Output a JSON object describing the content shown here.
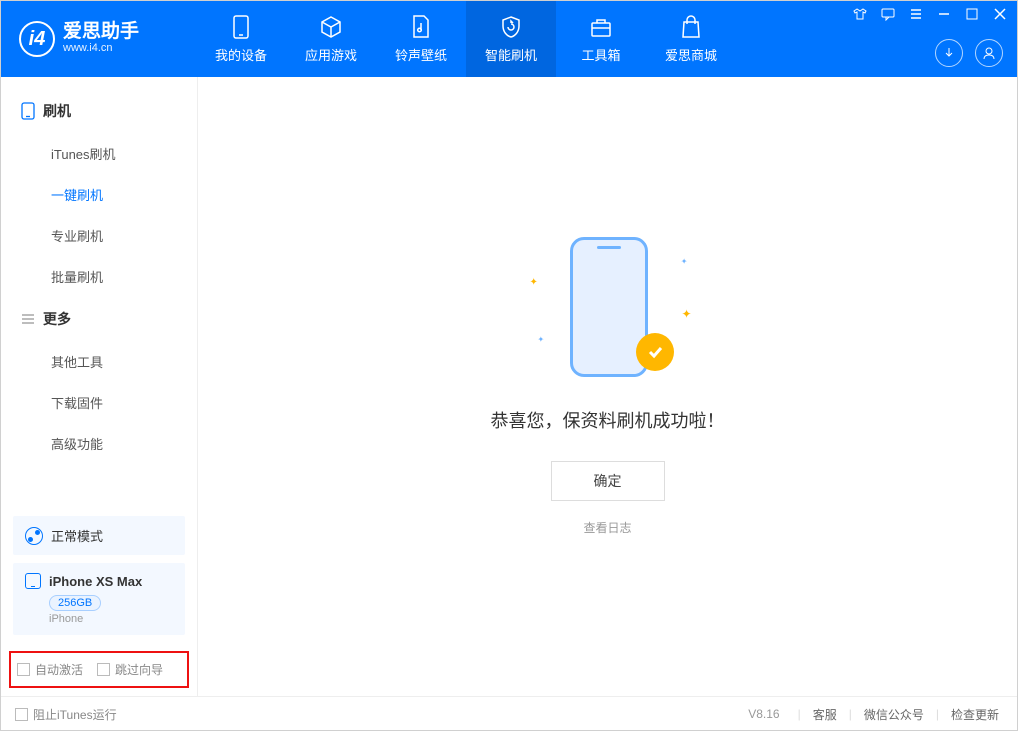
{
  "app": {
    "title": "爱思助手",
    "subtitle": "www.i4.cn"
  },
  "nav": [
    {
      "label": "我的设备"
    },
    {
      "label": "应用游戏"
    },
    {
      "label": "铃声壁纸"
    },
    {
      "label": "智能刷机"
    },
    {
      "label": "工具箱"
    },
    {
      "label": "爱思商城"
    }
  ],
  "sidebar": {
    "section1": {
      "title": "刷机",
      "items": [
        {
          "label": "iTunes刷机"
        },
        {
          "label": "一键刷机"
        },
        {
          "label": "专业刷机"
        },
        {
          "label": "批量刷机"
        }
      ]
    },
    "section2": {
      "title": "更多",
      "items": [
        {
          "label": "其他工具"
        },
        {
          "label": "下载固件"
        },
        {
          "label": "高级功能"
        }
      ]
    }
  },
  "mode": {
    "label": "正常模式"
  },
  "device": {
    "name": "iPhone XS Max",
    "storage": "256GB",
    "type": "iPhone"
  },
  "checks": {
    "auto_activate": "自动激活",
    "skip_guide": "跳过向导"
  },
  "main": {
    "success_msg": "恭喜您，保资料刷机成功啦！",
    "ok_label": "确定",
    "log_link": "查看日志"
  },
  "footer": {
    "block_itunes": "阻止iTunes运行",
    "version": "V8.16",
    "links": [
      "客服",
      "微信公众号",
      "检查更新"
    ]
  }
}
